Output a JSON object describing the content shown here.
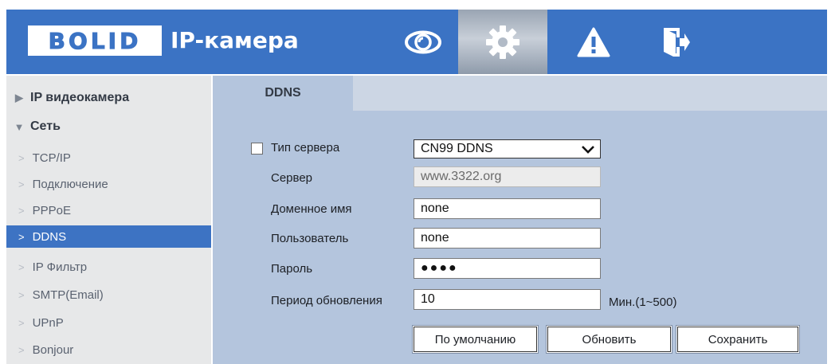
{
  "header": {
    "logo": "BOLID",
    "title": "IP-камера",
    "nav": [
      {
        "icon": "eye-icon",
        "active": false
      },
      {
        "icon": "gear-icon",
        "active": true
      },
      {
        "icon": "warning-icon",
        "active": false
      },
      {
        "icon": "exit-icon",
        "active": false
      }
    ],
    "accent_color": "#3b73c4"
  },
  "sidebar": {
    "groups": [
      {
        "label": "IP видеокамера",
        "expanded": false
      },
      {
        "label": "Сеть",
        "expanded": true
      }
    ],
    "items": [
      "TCP/IP",
      "Подключение",
      "PPPoE",
      "DDNS",
      "IP Фильтр",
      "SMTP(Email)",
      "UPnP",
      "Bonjour"
    ],
    "active_item": "DDNS"
  },
  "tab": {
    "label": "DDNS"
  },
  "form": {
    "server_type_label": "Тип сервера",
    "server_type_checked": false,
    "server_type_value": "CN99 DDNS",
    "server_label": "Сервер",
    "server_value": "www.3322.org",
    "domain_label": "Доменное имя",
    "domain_value": "none",
    "user_label": "Пользователь",
    "user_value": "none",
    "password_label": "Пароль",
    "password_value": "●●●●",
    "period_label": "Период обновления",
    "period_value": "10",
    "period_unit": "Мин.(1~500)"
  },
  "buttons": {
    "default": "По умолчанию",
    "refresh": "Обновить",
    "save": "Сохранить"
  }
}
